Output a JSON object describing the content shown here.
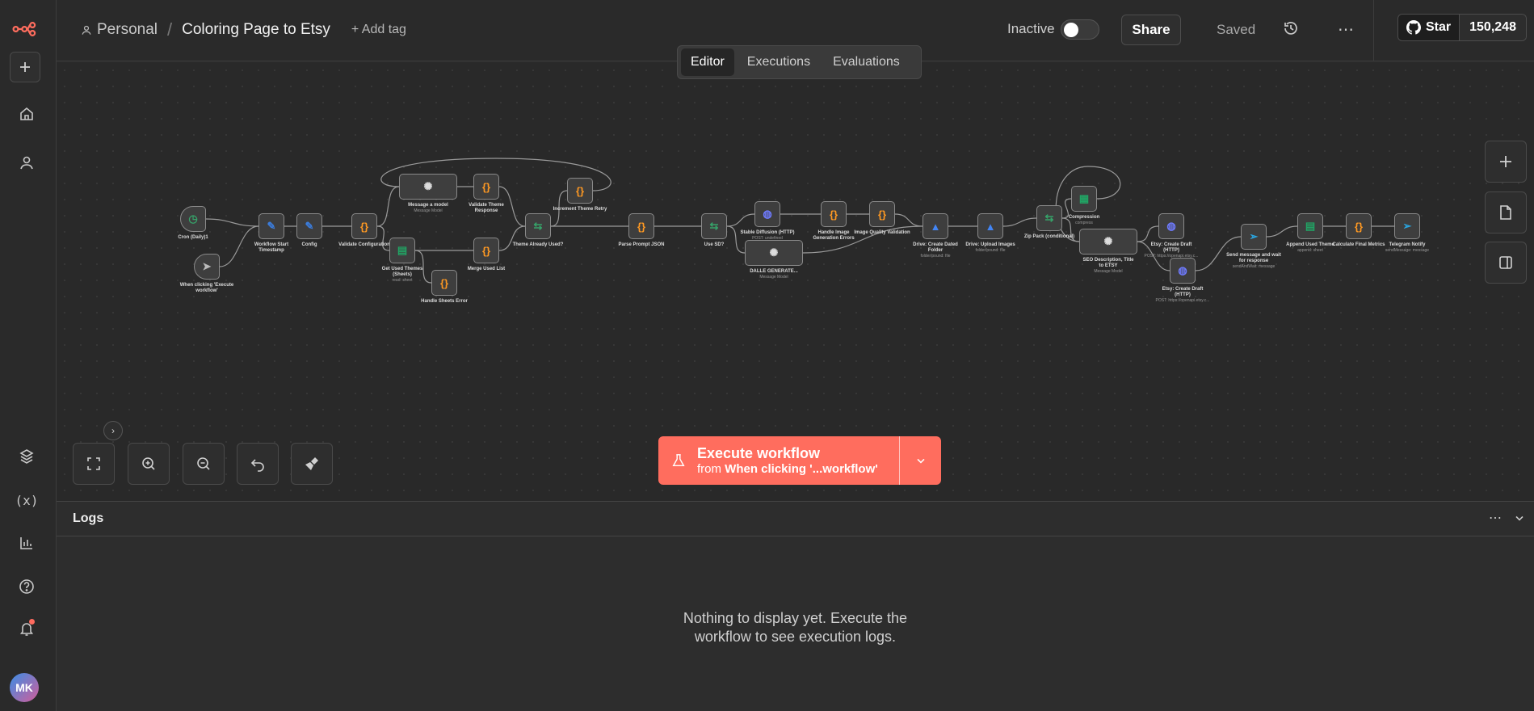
{
  "header": {
    "breadcrumb_owner": "Personal",
    "breadcrumb_sep": "/",
    "workflow_title": "Coloring Page to Etsy",
    "add_tag": "+ Add tag",
    "status_label": "Inactive",
    "share": "Share",
    "save_state": "Saved"
  },
  "github": {
    "star_label": "Star",
    "star_count": "150,248"
  },
  "tabs": [
    {
      "label": "Editor",
      "active": true
    },
    {
      "label": "Executions"
    },
    {
      "label": "Evaluations"
    }
  ],
  "nodes": [
    {
      "id": "cron",
      "label": "Cron (Daily)1",
      "icon": "clock-icon",
      "color": "#36a269"
    },
    {
      "id": "manual",
      "label": "When clicking 'Execute workflow'",
      "icon": "cursor-icon",
      "color": "#bbbbbb"
    },
    {
      "id": "start_ts",
      "label": "Workflow Start Timestamp",
      "icon": "pencil-icon",
      "color": "#3b7ddd"
    },
    {
      "id": "config",
      "label": "Config",
      "icon": "pencil-icon",
      "color": "#3b7ddd"
    },
    {
      "id": "validate_cfg",
      "label": "Validate Configuration",
      "icon": "code-icon",
      "color": "#ff9922"
    },
    {
      "id": "msg_model",
      "label": "Message a model",
      "sub": "Message Model",
      "icon": "openai-icon",
      "color": "#dddddd"
    },
    {
      "id": "validate_theme",
      "label": "Validate Theme Response",
      "icon": "code-icon",
      "color": "#ff9922"
    },
    {
      "id": "get_used",
      "label": "Get Used Themes (Sheets)",
      "sub": "read: sheet",
      "icon": "sheets-icon",
      "color": "#21a464"
    },
    {
      "id": "merge_used",
      "label": "Merge Used List",
      "icon": "code-icon",
      "color": "#ff9922"
    },
    {
      "id": "handle_sheets",
      "label": "Handle Sheets Error",
      "icon": "code-icon",
      "color": "#ff9922"
    },
    {
      "id": "theme_used",
      "label": "Theme Already Used?",
      "icon": "if-icon",
      "color": "#36a269"
    },
    {
      "id": "increment",
      "label": "Increment Theme Retry",
      "icon": "code-icon",
      "color": "#ff9922"
    },
    {
      "id": "parse_prompt",
      "label": "Parse Prompt JSON",
      "icon": "code-icon",
      "color": "#ff9922"
    },
    {
      "id": "use_sd",
      "label": "Use SD?",
      "icon": "if-icon",
      "color": "#36a269"
    },
    {
      "id": "stable_diff",
      "label": "Stable Diffusion (HTTP)",
      "sub": "POST: undefined",
      "icon": "globe-icon",
      "color": "#6f7bff"
    },
    {
      "id": "dalle",
      "label": "DALLE GENERATE...",
      "sub": "Message Model",
      "icon": "openai-icon",
      "color": "#dddddd"
    },
    {
      "id": "handle_img",
      "label": "Handle Image Generation Errors",
      "icon": "code-icon",
      "color": "#ff9922"
    },
    {
      "id": "img_quality",
      "label": "Image Quality Validation",
      "icon": "code-icon",
      "color": "#ff9922"
    },
    {
      "id": "drive_folder",
      "label": "Drive: Create Dated Folder",
      "sub": "folder/pound: file",
      "icon": "drive-icon",
      "color": "#4285f4"
    },
    {
      "id": "drive_upload",
      "label": "Drive: Upload Images",
      "sub": "folder/pound: file",
      "icon": "drive-icon",
      "color": "#4285f4"
    },
    {
      "id": "zip_pack",
      "label": "Zip Pack (conditional)",
      "icon": "if-icon",
      "color": "#36a269"
    },
    {
      "id": "compression",
      "label": "Compression",
      "sub": "compress",
      "icon": "file-icon",
      "color": "#21a464"
    },
    {
      "id": "seo",
      "label": "SEO Description, Title to ETSY",
      "sub": "Message Model",
      "icon": "openai-icon",
      "color": "#dddddd"
    },
    {
      "id": "etsy_draft1",
      "label": "Etsy: Create Draft (HTTP)",
      "sub": "POST: https://openapi.etsy.c...",
      "icon": "globe-icon",
      "color": "#6f7bff"
    },
    {
      "id": "etsy_draft2",
      "label": "Etsy: Create Draft (HTTP)",
      "sub": "POST: https://openapi.etsy.c...",
      "icon": "globe-icon",
      "color": "#6f7bff"
    },
    {
      "id": "send_wait",
      "label": "Send message and wait for response",
      "sub": "sendAndWait: message",
      "icon": "telegram-icon",
      "color": "#2aa5e0"
    },
    {
      "id": "append_used",
      "label": "Append Used Theme",
      "sub": "append: sheet",
      "icon": "sheets-icon",
      "color": "#21a464"
    },
    {
      "id": "final_metrics",
      "label": "Calculate Final Metrics",
      "icon": "code-icon",
      "color": "#ff9922"
    },
    {
      "id": "telegram_notify",
      "label": "Telegram Notify",
      "sub": "sendMessage: message",
      "icon": "telegram-icon",
      "color": "#2aa5e0"
    }
  ],
  "execute": {
    "title": "Execute workflow",
    "from_prefix": "from",
    "from_target": "When clicking '...workflow'"
  },
  "logs": {
    "title": "Logs",
    "empty_message": "Nothing to display yet. Execute the workflow to see execution logs."
  },
  "avatar": {
    "initials": "MK"
  },
  "colors": {
    "accent": "#ff6d5e",
    "canvas": "#292929",
    "sidebar": "#2a2a2a"
  }
}
